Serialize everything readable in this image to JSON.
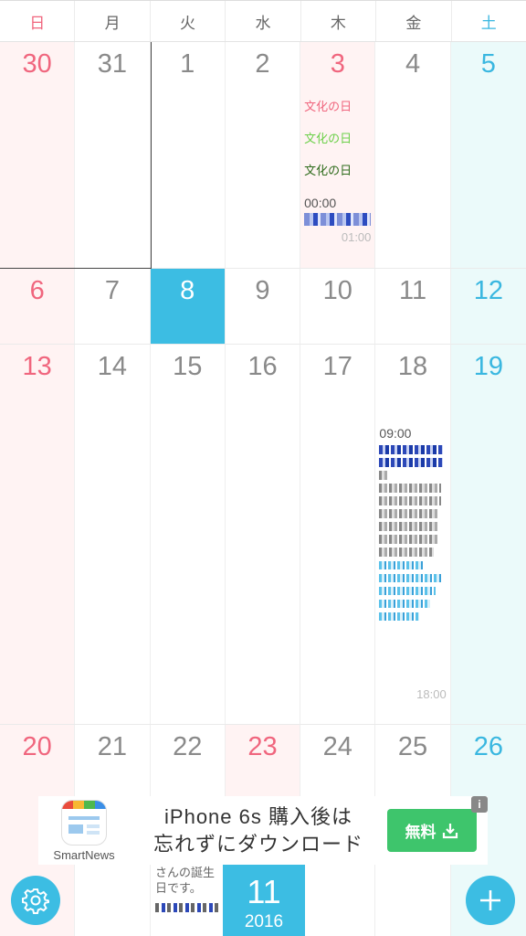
{
  "weekdays": [
    "日",
    "月",
    "火",
    "水",
    "木",
    "金",
    "土"
  ],
  "weeks": [
    [
      "30",
      "31",
      "1",
      "2",
      "3",
      "4",
      "5"
    ],
    [
      "6",
      "7",
      "8",
      "9",
      "10",
      "11",
      "12"
    ],
    [
      "13",
      "14",
      "15",
      "16",
      "17",
      "18",
      "19"
    ],
    [
      "20",
      "21",
      "22",
      "23",
      "24",
      "25",
      "26"
    ]
  ],
  "events": {
    "thu3_holiday_1": "文化の日",
    "thu3_holiday_2": "文化の日",
    "thu3_holiday_3": "文化の日",
    "thu3_start_time": "00:00",
    "thu3_end_time": "01:00",
    "fri18_start_time": "09:00",
    "fri18_end_time": "18:00",
    "tue_below_text": "さんの誕生日です。"
  },
  "month_badge": {
    "month": "11",
    "year": "2016"
  },
  "ad": {
    "brand": "SmartNews",
    "line1": "iPhone 6s 購入後は",
    "line2": "忘れずにダウンロード",
    "button": "無料",
    "info": "i"
  },
  "icons": {
    "settings": "gear-icon",
    "add": "plus-icon",
    "download": "download-icon"
  },
  "colors": {
    "accent": "#3cbde3",
    "sunday": "#f0667e",
    "saturday": "#3ab7e0",
    "ad_button": "#3ec56c"
  }
}
